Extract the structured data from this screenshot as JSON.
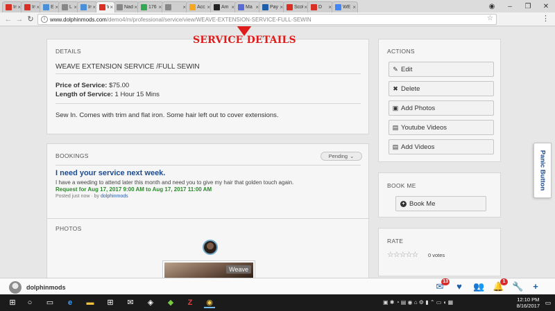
{
  "browser": {
    "tabs": [
      {
        "favicon": "gmail-icon",
        "title": "In",
        "color": "#d93025"
      },
      {
        "favicon": "gmail-icon",
        "title": "In",
        "color": "#d93025"
      },
      {
        "favicon": "link-icon",
        "title": "E",
        "color": "#4a90d9"
      },
      {
        "favicon": "doc-icon",
        "title": "L",
        "color": "#888888"
      },
      {
        "favicon": "link-icon",
        "title": "In",
        "color": "#4a90d9"
      },
      {
        "favicon": "red-bars-icon",
        "title": "W",
        "color": "#d93025",
        "active": true
      },
      {
        "favicon": "globe-icon",
        "title": "Nad",
        "color": "#888888"
      },
      {
        "favicon": "maps-icon",
        "title": "176",
        "color": "#34a853"
      },
      {
        "favicon": "www-icon",
        "title": "",
        "color": "#888888"
      },
      {
        "favicon": "accessibility-icon",
        "title": "Acc",
        "color": "#f5a623"
      },
      {
        "favicon": "amazon-icon",
        "title": "Am",
        "color": "#222222"
      },
      {
        "favicon": "mail-icon",
        "title": "Ma",
        "color": "#5b6bd4"
      },
      {
        "favicon": "paypal-icon",
        "title": "Pay",
        "color": "#1f5fa8"
      },
      {
        "favicon": "scot-icon",
        "title": "Scot",
        "color": "#d93025"
      },
      {
        "favicon": "youtube-icon",
        "title": "D",
        "color": "#d93025"
      },
      {
        "favicon": "google-icon",
        "title": "WE",
        "color": "#4285f4"
      }
    ],
    "url_host": "www.dolphinmods.com",
    "url_path": "/demo4/m/professional/service/view/WEAVE-EXTENSION-SERVICE-FULL-SEWIN"
  },
  "overlay": {
    "title": "SERVICE DETAILS"
  },
  "details": {
    "heading": "DETAILS",
    "service_name": "WEAVE EXTENSION SERVICE /FULL SEWIN",
    "price_label": "Price of Service:",
    "price_value": "$75.00",
    "length_label": "Length of Service:",
    "length_value": "1 Hour 15 Mins",
    "description": "Sew In. Comes with trim and flat iron. Some hair left out to cover extensions."
  },
  "bookings": {
    "heading": "BOOKINGS",
    "status_filter": "Pending",
    "item": {
      "title": "I need your service next week.",
      "message": "I have a weeding to attend later this month and need you to give my hair that golden touch again.",
      "request": "Request for Aug 17, 2017 9:00 AM to Aug 17, 2017 11:00 AM",
      "posted_prefix": "Posted just now · by",
      "posted_by": "dolphinmods"
    }
  },
  "photos": {
    "heading": "PHOTOS",
    "photo_label": "Weave"
  },
  "actions": {
    "heading": "ACTIONS",
    "buttons": [
      {
        "label": "Edit",
        "icon": "edit-icon"
      },
      {
        "label": "Delete",
        "icon": "delete-icon"
      },
      {
        "label": "Add Photos",
        "icon": "photo-icon"
      },
      {
        "label": "Youtube Videos",
        "icon": "film-icon"
      },
      {
        "label": "Add Videos",
        "icon": "film-icon"
      }
    ]
  },
  "book_me": {
    "heading": "BOOK ME",
    "button_label": "Book Me"
  },
  "rate": {
    "heading": "RATE",
    "stars": "☆☆☆☆☆",
    "votes": "0 votes"
  },
  "panic_button": "Panic Button",
  "app_bar": {
    "username": "dolphinmods",
    "inbox_count": "13",
    "notifications_count": "1"
  },
  "taskbar": {
    "time": "12:10 PM",
    "date": "8/16/2017"
  },
  "colors": {
    "overlay_red": "#e01b1b",
    "link_blue": "#1c4b8f",
    "request_green": "#2a8a2a",
    "appbar_blue": "#1f5fa8"
  }
}
